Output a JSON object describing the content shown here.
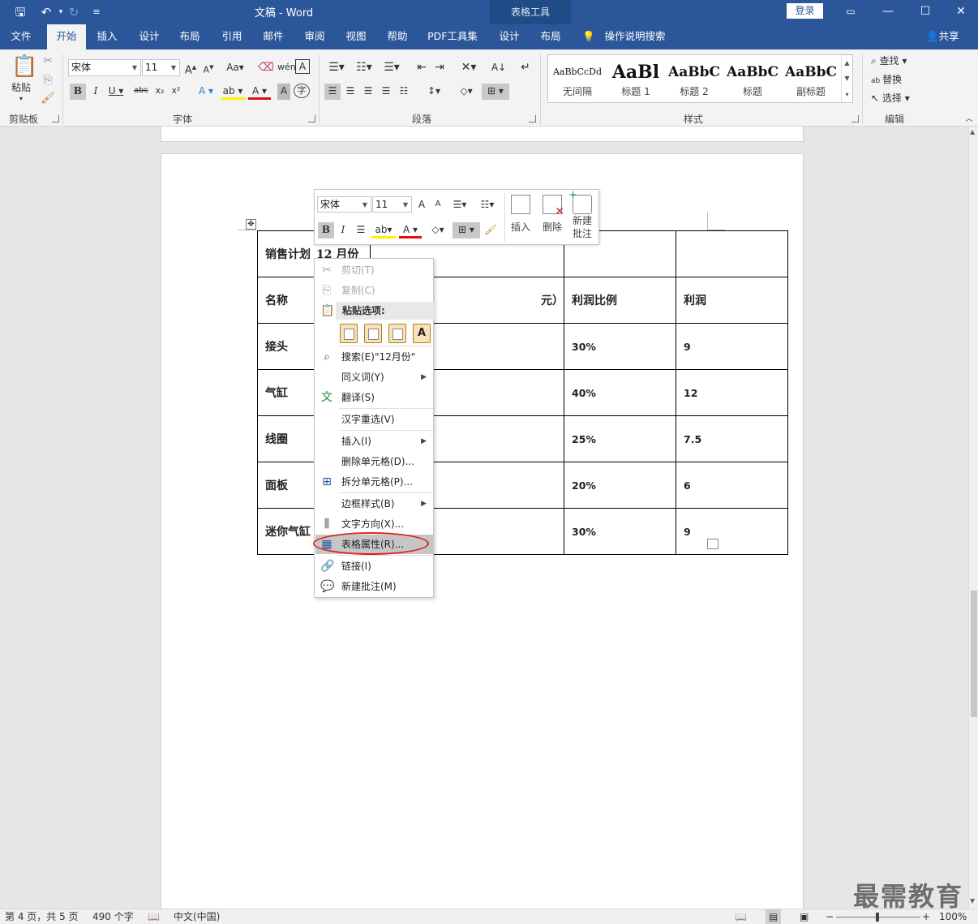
{
  "window": {
    "title": "文稿 - Word",
    "context_tab_group": "表格工具",
    "login_label": "登录"
  },
  "tabs": [
    "文件",
    "开始",
    "插入",
    "设计",
    "布局",
    "引用",
    "邮件",
    "审阅",
    "视图",
    "帮助",
    "PDF工具集",
    "设计",
    "布局"
  ],
  "active_tab": "开始",
  "tell_me": "操作说明搜索",
  "share": "共享",
  "ribbon": {
    "clipboard": {
      "label": "剪贴板",
      "paste": "粘贴"
    },
    "font": {
      "label": "字体",
      "font_name": "宋体",
      "font_size": "11"
    },
    "paragraph": {
      "label": "段落"
    },
    "styles": {
      "label": "样式",
      "items": [
        {
          "sample": "AaBbCcDd",
          "name": "无间隔"
        },
        {
          "sample": "AaBl",
          "name": "标题 1"
        },
        {
          "sample": "AaBbC",
          "name": "标题 2"
        },
        {
          "sample": "AaBbC",
          "name": "标题"
        },
        {
          "sample": "AaBbC",
          "name": "副标题"
        }
      ]
    },
    "editing": {
      "label": "编辑",
      "find": "查找",
      "replace": "替换",
      "select": "选择"
    }
  },
  "minibar": {
    "font_name": "宋体",
    "font_size": "11",
    "insert": "插入",
    "delete": "删除",
    "new_comment_1": "新建",
    "new_comment_2": "批注"
  },
  "table": {
    "rows": [
      [
        "销售计划",
        "12 月份",
        "",
        "",
        ""
      ],
      [
        "名称",
        "",
        "元）",
        "利润比例",
        "利润"
      ],
      [
        "接头",
        "",
        "",
        "30%",
        "9"
      ],
      [
        "气缸",
        "",
        "",
        "40%",
        "12"
      ],
      [
        "线圈",
        "",
        "",
        "25%",
        "7.5"
      ],
      [
        "面板",
        "",
        "",
        "20%",
        "6"
      ],
      [
        "迷你气缸",
        "",
        "",
        "30%",
        "9"
      ]
    ]
  },
  "context_menu": {
    "cut": "剪切(T)",
    "copy": "复制(C)",
    "paste_options": "粘贴选项:",
    "search": "搜索(E)\"12月份\"",
    "synonyms": "同义词(Y)",
    "translate": "翻译(S)",
    "reconvert": "汉字重选(V)",
    "insert": "插入(I)",
    "delete_cells": "删除单元格(D)...",
    "split_cells": "拆分单元格(P)...",
    "border_styles": "边框样式(B)",
    "text_direction": "文字方向(X)...",
    "table_properties": "表格属性(R)...",
    "link": "链接(I)",
    "new_comment": "新建批注(M)"
  },
  "status": {
    "page": "第 4 页，共 5 页",
    "words": "490 个字",
    "language": "中文(中国)",
    "zoom": "100%"
  },
  "watermark": "最需教育"
}
